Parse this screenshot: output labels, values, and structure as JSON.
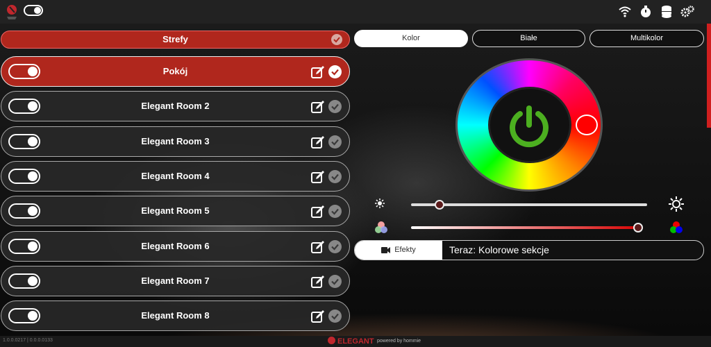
{
  "header": {
    "icons": [
      "wifi-icon",
      "stopwatch-icon",
      "database-icon",
      "settings-icon"
    ]
  },
  "zones": {
    "title": "Strefy",
    "rooms": [
      {
        "name": "Pokój",
        "active": true
      },
      {
        "name": "Elegant Room 2",
        "active": false
      },
      {
        "name": "Elegant Room 3",
        "active": false
      },
      {
        "name": "Elegant Room 4",
        "active": false
      },
      {
        "name": "Elegant Room 5",
        "active": false
      },
      {
        "name": "Elegant Room 6",
        "active": false
      },
      {
        "name": "Elegant Room 7",
        "active": false
      },
      {
        "name": "Elegant Room 8",
        "active": false
      }
    ]
  },
  "tabs": [
    {
      "label": "Kolor",
      "active": true
    },
    {
      "label": "Białe",
      "active": false
    },
    {
      "label": "Multikolor",
      "active": false
    }
  ],
  "color": {
    "selected": "#ff0000",
    "power_color": "#4caf20"
  },
  "sliders": {
    "brightness": 0.12,
    "saturation": 0.98
  },
  "effects": {
    "button_label": "Efekty",
    "status": "Teraz: Kolorowe sekcje"
  },
  "footer": {
    "version": "1.0.0.0217 | 0.0.0.0133",
    "brand": "ELEGANT",
    "powered": "powered by hommie"
  },
  "accent": "#b0271d"
}
